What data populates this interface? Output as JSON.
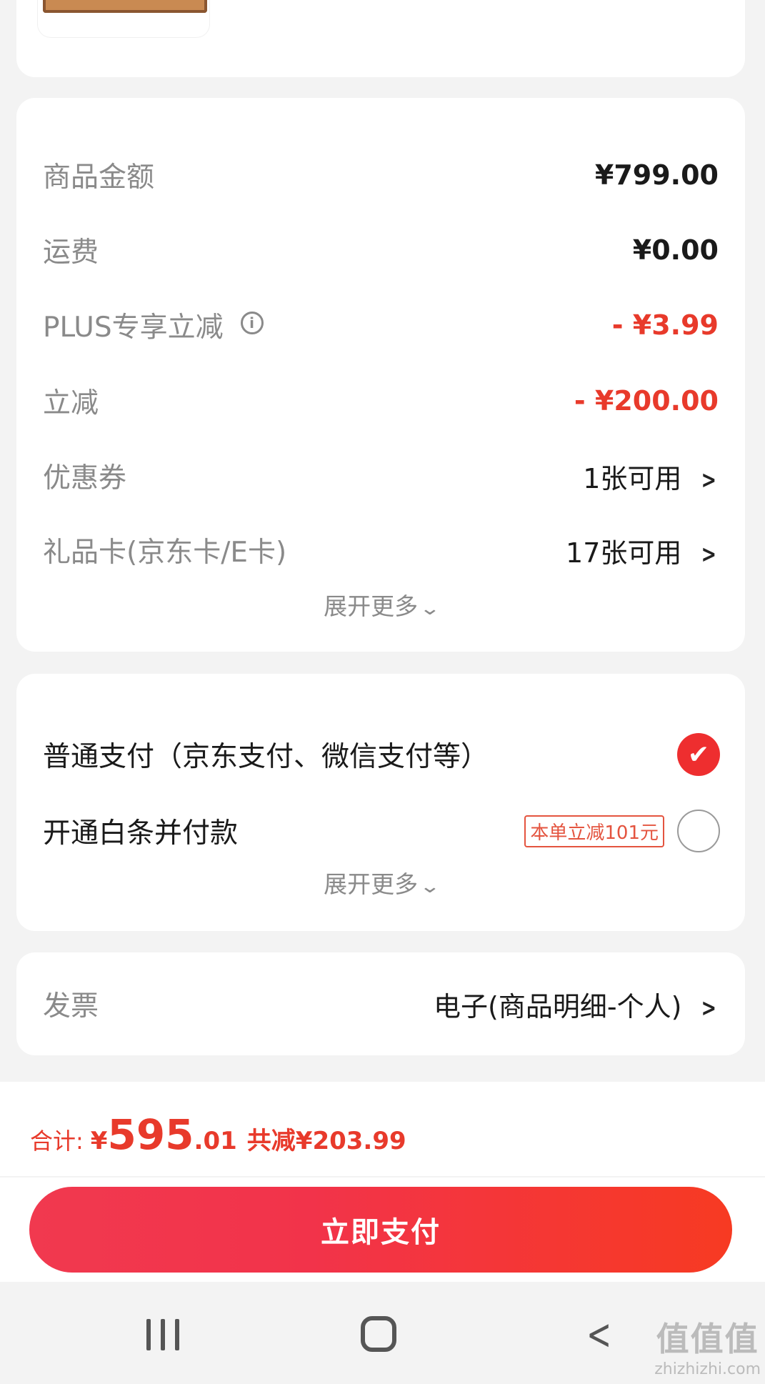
{
  "summary": {
    "rows": [
      {
        "label": "商品金额",
        "value": "¥799.00"
      },
      {
        "label": "运费",
        "value": "¥0.00"
      },
      {
        "label": "PLUS专享立减",
        "value": "- ¥3.99"
      },
      {
        "label": "立减",
        "value": "- ¥200.00"
      },
      {
        "label": "优惠券",
        "value": "1张可用"
      },
      {
        "label": "礼品卡(京东卡/E卡)",
        "value": "17张可用"
      }
    ],
    "expand_label": "展开更多"
  },
  "payment": {
    "options": [
      {
        "label": "普通支付（京东支付、微信支付等）",
        "selected": true
      },
      {
        "label": "开通白条并付款",
        "promo": "本单立减101元",
        "selected": false
      }
    ],
    "expand_label": "展开更多"
  },
  "invoice": {
    "label": "发票",
    "value": "电子(商品明细-个人)"
  },
  "footer": {
    "total_label": "合计:",
    "currency": "¥",
    "total_int": "595",
    "total_dec": ".01",
    "saved": "共减¥203.99",
    "pay_button": "立即支付"
  },
  "watermark": {
    "main": "值值值",
    "sub": "zhizhizhi.com"
  },
  "colors": {
    "accent": "#e83a2b",
    "background": "#f3f3f3"
  },
  "icons": {
    "info": "info-circle-icon",
    "chevron": "chevron-right-icon",
    "expand": "chevron-down-icon",
    "check": "check-icon"
  }
}
